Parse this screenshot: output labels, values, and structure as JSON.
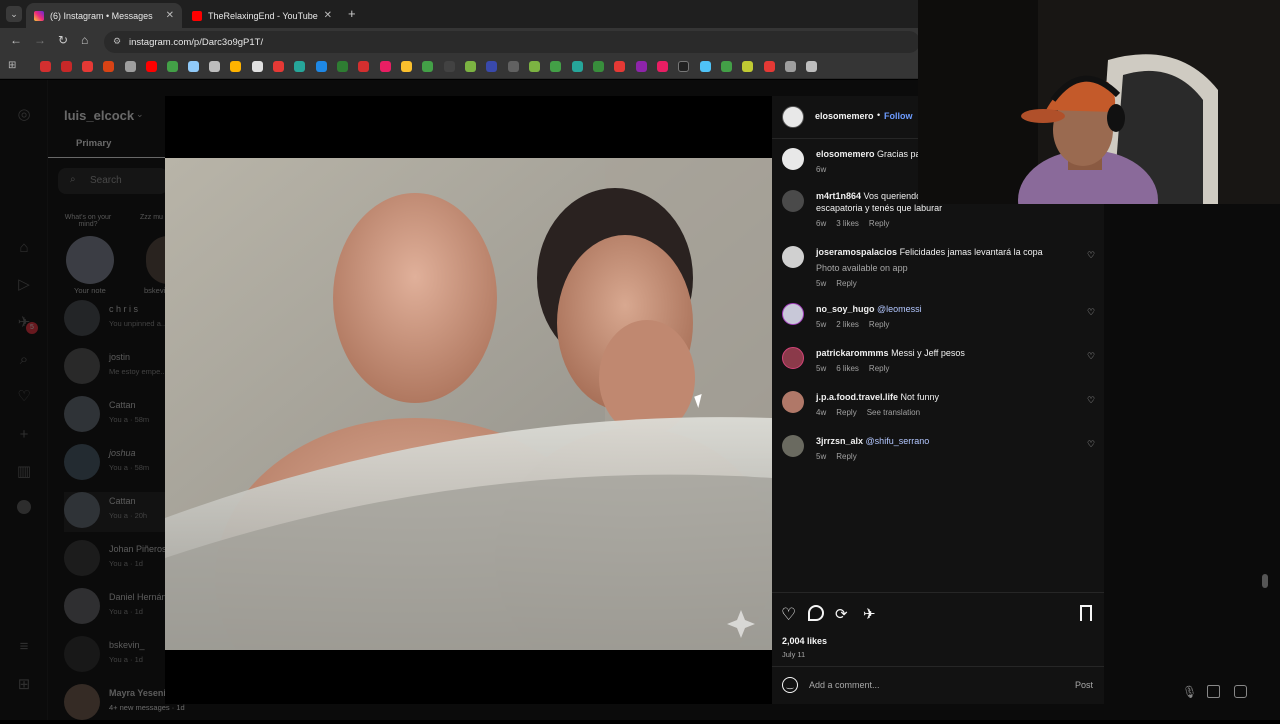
{
  "browser": {
    "tabs": [
      {
        "title": "(6) Instagram • Messages",
        "active": true
      },
      {
        "title": "TheRelaxingEnd - YouTube",
        "active": false
      }
    ],
    "url": "instagram.com/p/Darc3o9gP1T/"
  },
  "dm": {
    "username": "luis_elcock",
    "tab_primary": "Primary",
    "search_placeholder": "Search",
    "notes": [
      {
        "text": "What's on your mind?",
        "label": "Your note"
      },
      {
        "text": "Zzz mu alco",
        "label": "bskevi"
      }
    ],
    "threads": [
      {
        "name": "c h r i s",
        "sub": "You unpinned a..."
      },
      {
        "name": "jostin",
        "sub": "Me estoy empe..."
      },
      {
        "name": "Cattan",
        "sub": "You a · 58m"
      },
      {
        "name": "joshua",
        "sub": "You a · 58m"
      },
      {
        "name": "Cattan",
        "sub": "You a · 20h"
      },
      {
        "name": "Johan Piñeros",
        "sub": "You a · 1d"
      },
      {
        "name": "Daniel Hernández",
        "sub": "You a · 1d"
      },
      {
        "name": "bskevin_",
        "sub": "You a · 1d"
      },
      {
        "name": "Mayra Yeseni",
        "sub": "4+ new messages · 1d"
      }
    ],
    "notification_badge": "5"
  },
  "post": {
    "author": "elosomemero",
    "follow_label": "Follow",
    "comments": [
      {
        "user": "elosomemero",
        "text": "Gracias pa",
        "time": "6w",
        "likes": "",
        "reply": "",
        "extra": ""
      },
      {
        "user": "m4rt1n864",
        "text": "Vos queriendo... agarran ya no tenes escapatoria y tenés que laburar",
        "time": "6w",
        "likes": "3 likes",
        "reply": "Reply",
        "extra": ""
      },
      {
        "user": "joseramospalacios",
        "text": "Felicidades jamas levantará la copa",
        "sub": "Photo available on app",
        "time": "5w",
        "likes": "",
        "reply": "Reply",
        "extra": ""
      },
      {
        "user": "no_soy_hugo",
        "text": "@leomessi",
        "time": "5w",
        "likes": "2 likes",
        "reply": "Reply",
        "extra": ""
      },
      {
        "user": "patrickarommms",
        "text": "Messi y Jeff pesos",
        "time": "5w",
        "likes": "6 likes",
        "reply": "Reply",
        "extra": ""
      },
      {
        "user": "j.p.a.food.travel.life",
        "text": "Not funny",
        "time": "4w",
        "likes": "",
        "reply": "Reply",
        "extra": "See translation"
      },
      {
        "user": "3jrrzsn_alx",
        "text": "@shifu_serrano",
        "time": "5w",
        "likes": "",
        "reply": "Reply",
        "extra": ""
      }
    ],
    "likes": "2,004 likes",
    "date": "July 11",
    "comment_placeholder": "Add a comment...",
    "post_label": "Post"
  },
  "icons": [
    "instagram-icon",
    "home-icon",
    "reels-icon",
    "messages-icon",
    "search-icon",
    "heart-icon",
    "create-icon",
    "dashboard-icon",
    "profile-icon",
    "menu-icon",
    "more-icon",
    "like-icon",
    "comment-icon",
    "repost-icon",
    "share-icon",
    "bookmark-icon",
    "emoji-icon",
    "mic-icon",
    "gallery-icon",
    "sticker-icon"
  ]
}
